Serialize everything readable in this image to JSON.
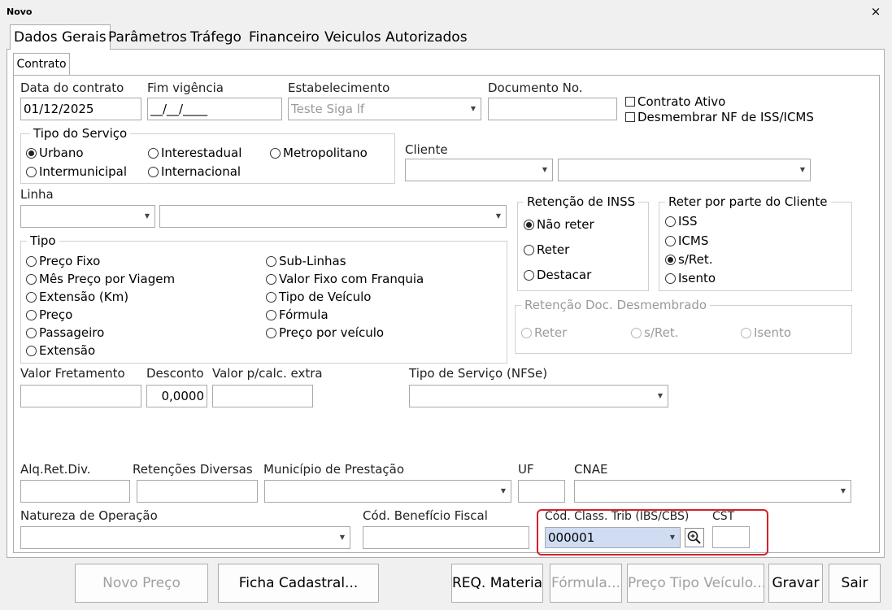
{
  "window": {
    "title": "Novo",
    "close_glyph": "×"
  },
  "tabs": [
    "Dados Gerais",
    "Parâmetros",
    "Tráfego",
    "Financeiro",
    "Veiculos Autorizados"
  ],
  "subtab": "Contrato",
  "fields": {
    "data_contrato": {
      "label": "Data do contrato",
      "value": "01/12/2025"
    },
    "fim_vigencia": {
      "label": "Fim vigência",
      "value": "__/__/____"
    },
    "estabelecimento": {
      "label": "Estabelecimento",
      "value": "Teste Siga lf"
    },
    "documento_no": {
      "label": "Documento No.",
      "value": ""
    },
    "cliente": {
      "label": "Cliente",
      "value1": "",
      "value2": ""
    },
    "linha": {
      "label": "Linha",
      "value1": "",
      "value2": ""
    },
    "valor_fretamento": {
      "label": "Valor Fretamento",
      "value": ""
    },
    "desconto": {
      "label": "Desconto",
      "value": "0,0000"
    },
    "valor_calc_extra": {
      "label": "Valor p/calc. extra",
      "value": ""
    },
    "tipo_servico_nfse": {
      "label": "Tipo de Serviço (NFSe)",
      "value": ""
    },
    "alq_ret_div": {
      "label": "Alq.Ret.Div.",
      "value": ""
    },
    "retencoes_diversas": {
      "label": "Retenções Diversas",
      "value": ""
    },
    "municipio_prestacao": {
      "label": "Município de Prestação",
      "value": ""
    },
    "uf": {
      "label": "UF",
      "value": ""
    },
    "cnae": {
      "label": "CNAE",
      "value": ""
    },
    "natureza_operacao": {
      "label": "Natureza de Operação",
      "value": ""
    },
    "cod_beneficio_fiscal": {
      "label": "Cód. Benefício Fiscal",
      "value": ""
    },
    "cod_class_trib": {
      "label": "Cód. Class. Trib (IBS/CBS)",
      "value": "000001"
    },
    "cst": {
      "label": "CST",
      "value": ""
    }
  },
  "checkboxes": {
    "contrato_ativo": "Contrato Ativo",
    "desmembrar": "Desmembrar NF de ISS/ICMS"
  },
  "tipo_servico": {
    "title": "Tipo do Serviço",
    "options": [
      "Urbano",
      "Interestadual",
      "Metropolitano",
      "Intermunicipal",
      "Internacional"
    ],
    "selected": "Urbano"
  },
  "tipo": {
    "title": "Tipo",
    "options": [
      "Preço Fixo",
      "Mês Preço por Viagem",
      "Extensão (Km)",
      "Preço",
      "Passageiro",
      "Extensão",
      "Sub-Linhas",
      "Valor Fixo com Franquia",
      "Tipo de Veículo",
      "Fórmula",
      "Preço por veículo"
    ],
    "selected": ""
  },
  "retencao_inss": {
    "title": "Retenção de INSS",
    "options": [
      "Não reter",
      "Reter",
      "Destacar"
    ],
    "selected": "Não reter"
  },
  "reter_cliente": {
    "title": "Reter por parte do Cliente",
    "options": [
      "ISS",
      "ICMS",
      "s/Ret.",
      "Isento"
    ],
    "selected": "s/Ret."
  },
  "retencao_doc": {
    "title": "Retenção Doc. Desmembrado",
    "options": [
      "Reter",
      "s/Ret.",
      "Isento"
    ],
    "selected": ""
  },
  "buttons": {
    "novo_preco": "Novo Preço",
    "ficha_cadastral": "Ficha Cadastral...",
    "req_material": "REQ. Material",
    "formula": "Fórmula...",
    "preco_tipo_veiculo": "Preço Tipo Veículo...",
    "gravar": "Gravar",
    "sair": "Sair"
  },
  "colors": {
    "highlight_frame": "#d3212a",
    "selected_field": "#cfdcf2"
  }
}
